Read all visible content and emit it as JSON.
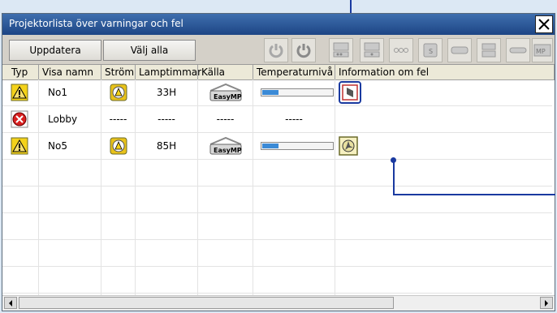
{
  "window": {
    "title": "Projektorlista över varningar och fel"
  },
  "toolbar": {
    "update_label": "Uppdatera",
    "select_all_label": "Välj alla"
  },
  "columns": [
    "Typ",
    "Visa namn",
    "Ström",
    "Lamptimmar",
    "Källa",
    "Temperaturnivå",
    "Information om fel"
  ],
  "rows": [
    {
      "type": "warning",
      "name": "No1",
      "power": "warning",
      "lamp": "33H",
      "source": "EasyMP",
      "temp": 0.22,
      "error": "lamp-error"
    },
    {
      "type": "error",
      "name": "Lobby",
      "power": "-----",
      "lamp": "-----",
      "source": "-----",
      "temp": "-----",
      "error": ""
    },
    {
      "type": "warning",
      "name": "No5",
      "power": "warning",
      "lamp": "85H",
      "source": "EasyMP",
      "temp": 0.22,
      "error": "fan-error"
    }
  ],
  "colors": {
    "titlebar": "#1d4585",
    "callout": "#1a3aa0",
    "temp_bar": "#3b8ad6"
  }
}
